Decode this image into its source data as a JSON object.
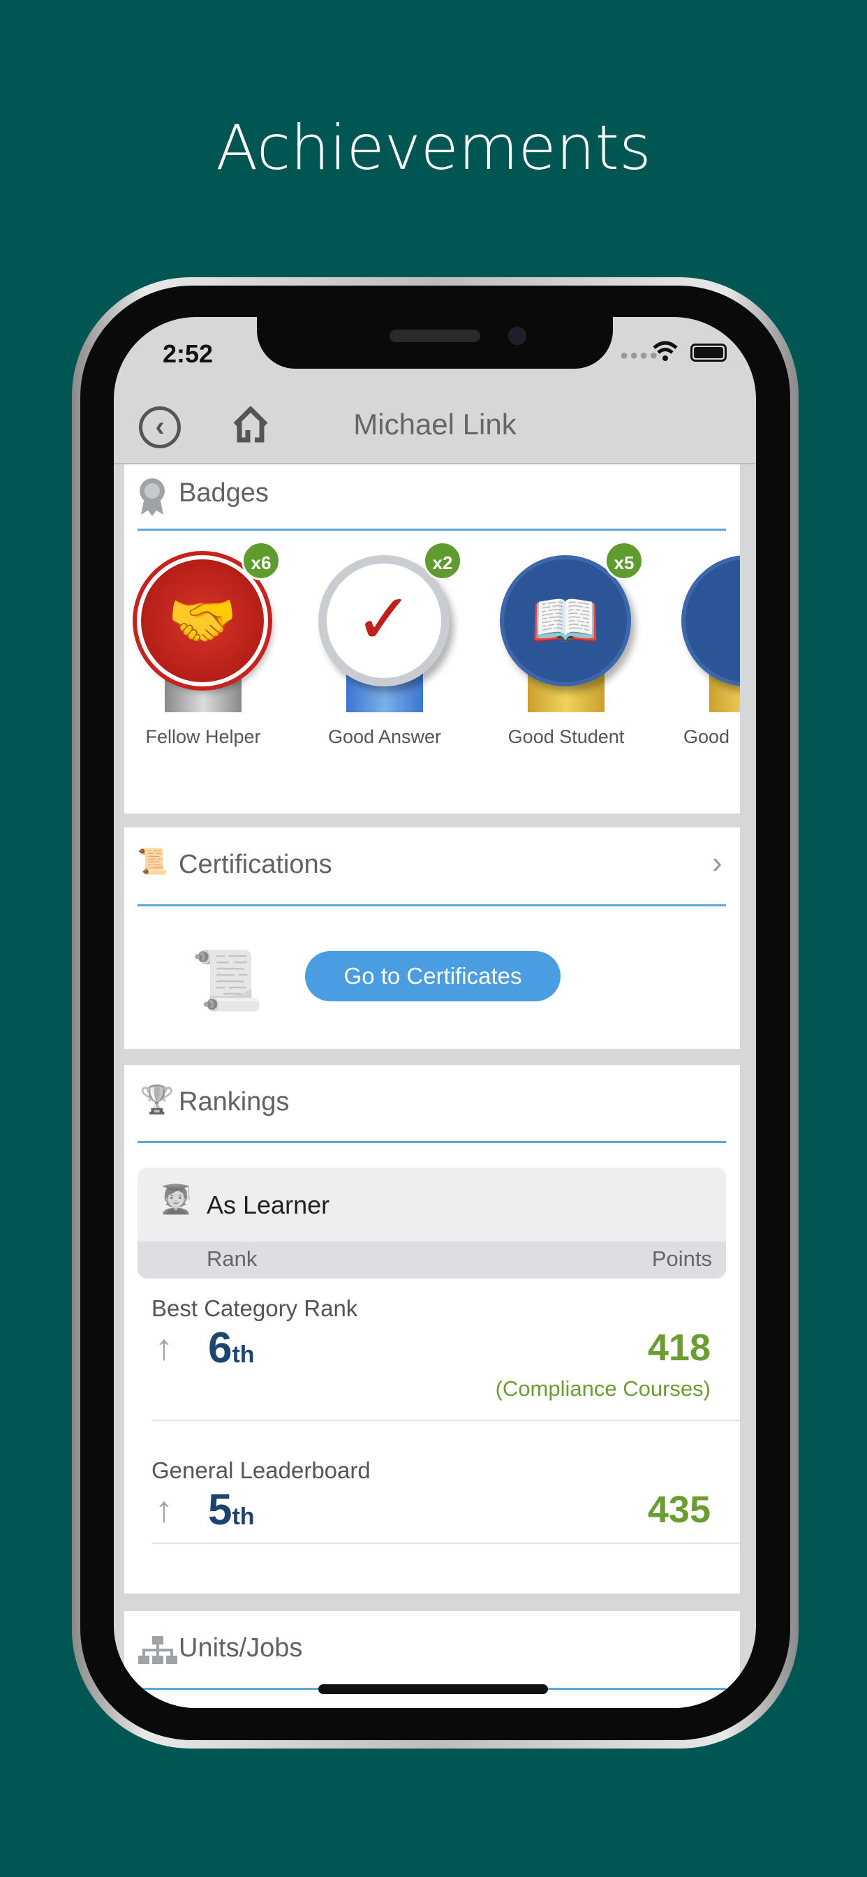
{
  "page_title": "Achievements",
  "status": {
    "time": "2:52"
  },
  "nav": {
    "title": "Michael Link"
  },
  "badges": {
    "header": "Badges",
    "items": [
      {
        "name": "Fellow Helper",
        "count": "x6",
        "color": "#c9221c"
      },
      {
        "name": "Good Answer",
        "count": "x2",
        "color": "#ffffff"
      },
      {
        "name": "Good Student",
        "count": "x5",
        "color": "#2c5597"
      },
      {
        "name": "Good",
        "count": "",
        "color": "#2c5597"
      }
    ]
  },
  "certifications": {
    "header": "Certifications",
    "button": "Go to Certificates"
  },
  "rankings": {
    "header": "Rankings",
    "learner_label": "As Learner",
    "col_rank": "Rank",
    "col_points": "Points",
    "rows": [
      {
        "label": "Best Category Rank",
        "rank": "6",
        "suffix": "th",
        "points": "418",
        "category": "(Compliance Courses)"
      },
      {
        "label": "General Leaderboard",
        "rank": "5",
        "suffix": "th",
        "points": "435"
      }
    ]
  },
  "units": {
    "header": "Units/Jobs"
  },
  "colors": {
    "accent": "#4a9de0",
    "points": "#6a9e32",
    "rank": "#1d4370",
    "background": "#005652"
  }
}
